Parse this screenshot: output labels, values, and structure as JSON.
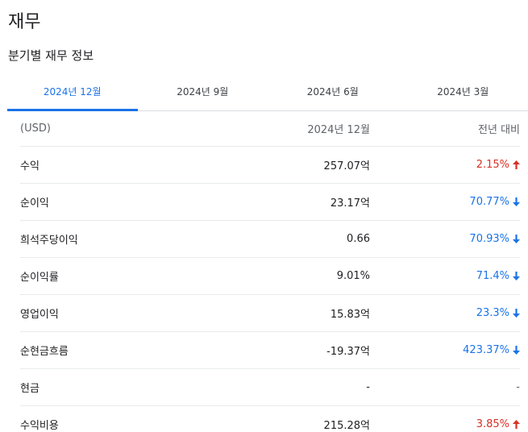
{
  "section": {
    "title": "재무",
    "subtitle": "분기별 재무 정보"
  },
  "tabs": [
    {
      "label": "2024년 12월",
      "active": true
    },
    {
      "label": "2024년 9월",
      "active": false
    },
    {
      "label": "2024년 6월",
      "active": false
    },
    {
      "label": "2024년 3월",
      "active": false
    }
  ],
  "table": {
    "header": {
      "label": "(USD)",
      "value": "2024년 12월",
      "change": "전년 대비"
    },
    "rows": [
      {
        "label": "수익",
        "value": "257.07억",
        "change": "2.15%",
        "direction": "up"
      },
      {
        "label": "순이익",
        "value": "23.17억",
        "change": "70.77%",
        "direction": "down"
      },
      {
        "label": "희석주당이익",
        "value": "0.66",
        "change": "70.93%",
        "direction": "down"
      },
      {
        "label": "순이익률",
        "value": "9.01%",
        "change": "71.4%",
        "direction": "down"
      },
      {
        "label": "영업이익",
        "value": "15.83억",
        "change": "23.3%",
        "direction": "down"
      },
      {
        "label": "순현금흐름",
        "value": "-19.37억",
        "change": "423.37%",
        "direction": "down"
      },
      {
        "label": "현금",
        "value": "-",
        "change": "-",
        "direction": "none"
      },
      {
        "label": "수익비용",
        "value": "215.28억",
        "change": "3.85%",
        "direction": "up"
      }
    ]
  },
  "colors": {
    "accent": "#1a73e8",
    "up": "#d93025",
    "down": "#1a73e8"
  },
  "icons": {
    "up": "arrow-up-icon",
    "down": "arrow-down-icon"
  }
}
